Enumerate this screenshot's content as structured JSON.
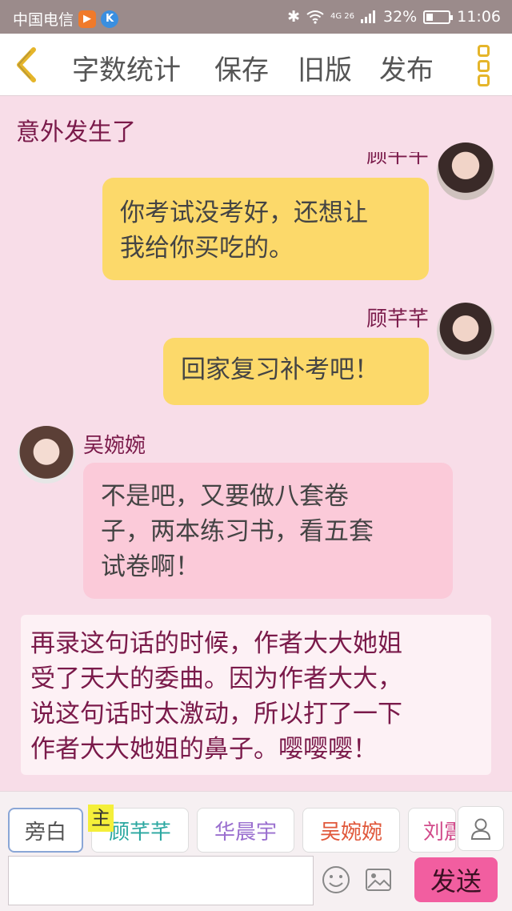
{
  "status_bar": {
    "carrier": "中国电信",
    "signal_text": "4G 26",
    "battery": "32%",
    "battery_level": 0.32,
    "time": "11:06"
  },
  "toolbar": {
    "word_count": "字数统计",
    "save": "保存",
    "old_version": "旧版",
    "publish": "发布"
  },
  "chat_title": "意外发生了",
  "messages": [
    {
      "side": "right",
      "name": "顾芊芊",
      "text_lines": [
        "你考试没考好，还想让",
        "我给你买吃的。"
      ],
      "color": "#fcd96a"
    },
    {
      "side": "right",
      "name": "顾芊芊",
      "text_lines": [
        "回家复习补考吧！"
      ],
      "color": "#fcd96a"
    },
    {
      "side": "left",
      "name": "吴婉婉",
      "text_lines": [
        "不是吧，又要做八套卷",
        "子，两本练习书，看五套",
        "试卷啊！"
      ],
      "color": "#fbcad9"
    }
  ],
  "narration_lines": [
    "再录这句话的时候，作者大大她姐",
    "受了天大的委曲。因为作者大大，",
    "说这句话时太激动，所以打了一下",
    "作者大大她姐的鼻子。嘤嘤嘤！"
  ],
  "roles": [
    {
      "label": "旁白",
      "color": "#555555"
    },
    {
      "label": "顾芊芊",
      "color": "#2aa7a0"
    },
    {
      "label": "华晨宇",
      "color": "#9a6fcf"
    },
    {
      "label": "吴婉婉",
      "color": "#e0573a"
    },
    {
      "label": "刘震",
      "color": "#d14a8a"
    }
  ],
  "main_tag": "主",
  "send_label": "发送",
  "icons": {
    "back": "chevron-left-icon",
    "more": "more-vertical-icon",
    "user": "user-icon",
    "emoji": "smiley-icon",
    "image": "image-icon"
  },
  "colors": {
    "accent_yellow": "#e5b52a",
    "send_pink": "#f25ea0",
    "background": "#f8dde8"
  }
}
